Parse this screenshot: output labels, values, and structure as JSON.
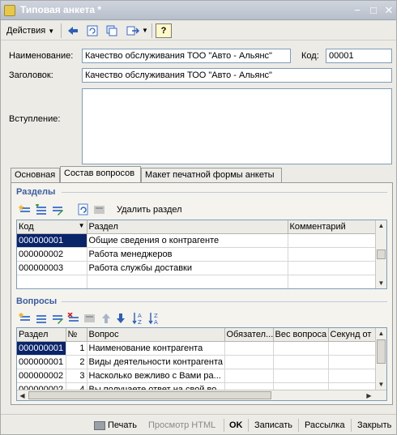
{
  "window": {
    "title": "Типовая анкета *"
  },
  "toolbar": {
    "actions_label": "Действия",
    "help_label": "?"
  },
  "form": {
    "name_label": "Наименование:",
    "name_value": "Качество обслуживания ТОО \"Авто - Альянс\"",
    "code_label": "Код:",
    "code_value": "00001",
    "header_label": "Заголовок:",
    "header_value": "Качество обслуживания ТОО \"Авто - Альянс\"",
    "intro_label": "Вступление:",
    "intro_value": ""
  },
  "tabs": [
    {
      "label": "Основная",
      "active": false
    },
    {
      "label": "Состав вопросов",
      "active": true
    },
    {
      "label": "Макет печатной формы анкеты",
      "active": false
    }
  ],
  "sections": {
    "title": "Разделы",
    "delete_label": "Удалить раздел",
    "columns": [
      "Код",
      "Раздел",
      "Комментарий"
    ],
    "rows": [
      {
        "code": "000000001",
        "name": "Общие сведения о контрагенте",
        "comment": ""
      },
      {
        "code": "000000002",
        "name": "Работа менеджеров",
        "comment": ""
      },
      {
        "code": "000000003",
        "name": "Работа службы доставки",
        "comment": ""
      }
    ]
  },
  "questions": {
    "title": "Вопросы",
    "columns": [
      "Раздел",
      "№",
      "Вопрос",
      "Обязател...",
      "Вес вопроса",
      "Секунд от"
    ],
    "rows": [
      {
        "section": "000000001",
        "num": "1",
        "question": "Наименование контрагента"
      },
      {
        "section": "000000001",
        "num": "2",
        "question": "Виды деятельности контрагента"
      },
      {
        "section": "000000002",
        "num": "3",
        "question": "Насколько вежливо с Вами ра..."
      },
      {
        "section": "000000002",
        "num": "4",
        "question": "Вы получаете ответ на свой во..."
      }
    ]
  },
  "bottom": {
    "print": "Печать",
    "preview_html": "Просмотр HTML",
    "ok": "OK",
    "save": "Записать",
    "mailing": "Рассылка",
    "close": "Закрыть"
  },
  "colors": {
    "selection": "#0a246a",
    "section_title": "#3c5d9e",
    "window_bg": "#ecebe6"
  }
}
